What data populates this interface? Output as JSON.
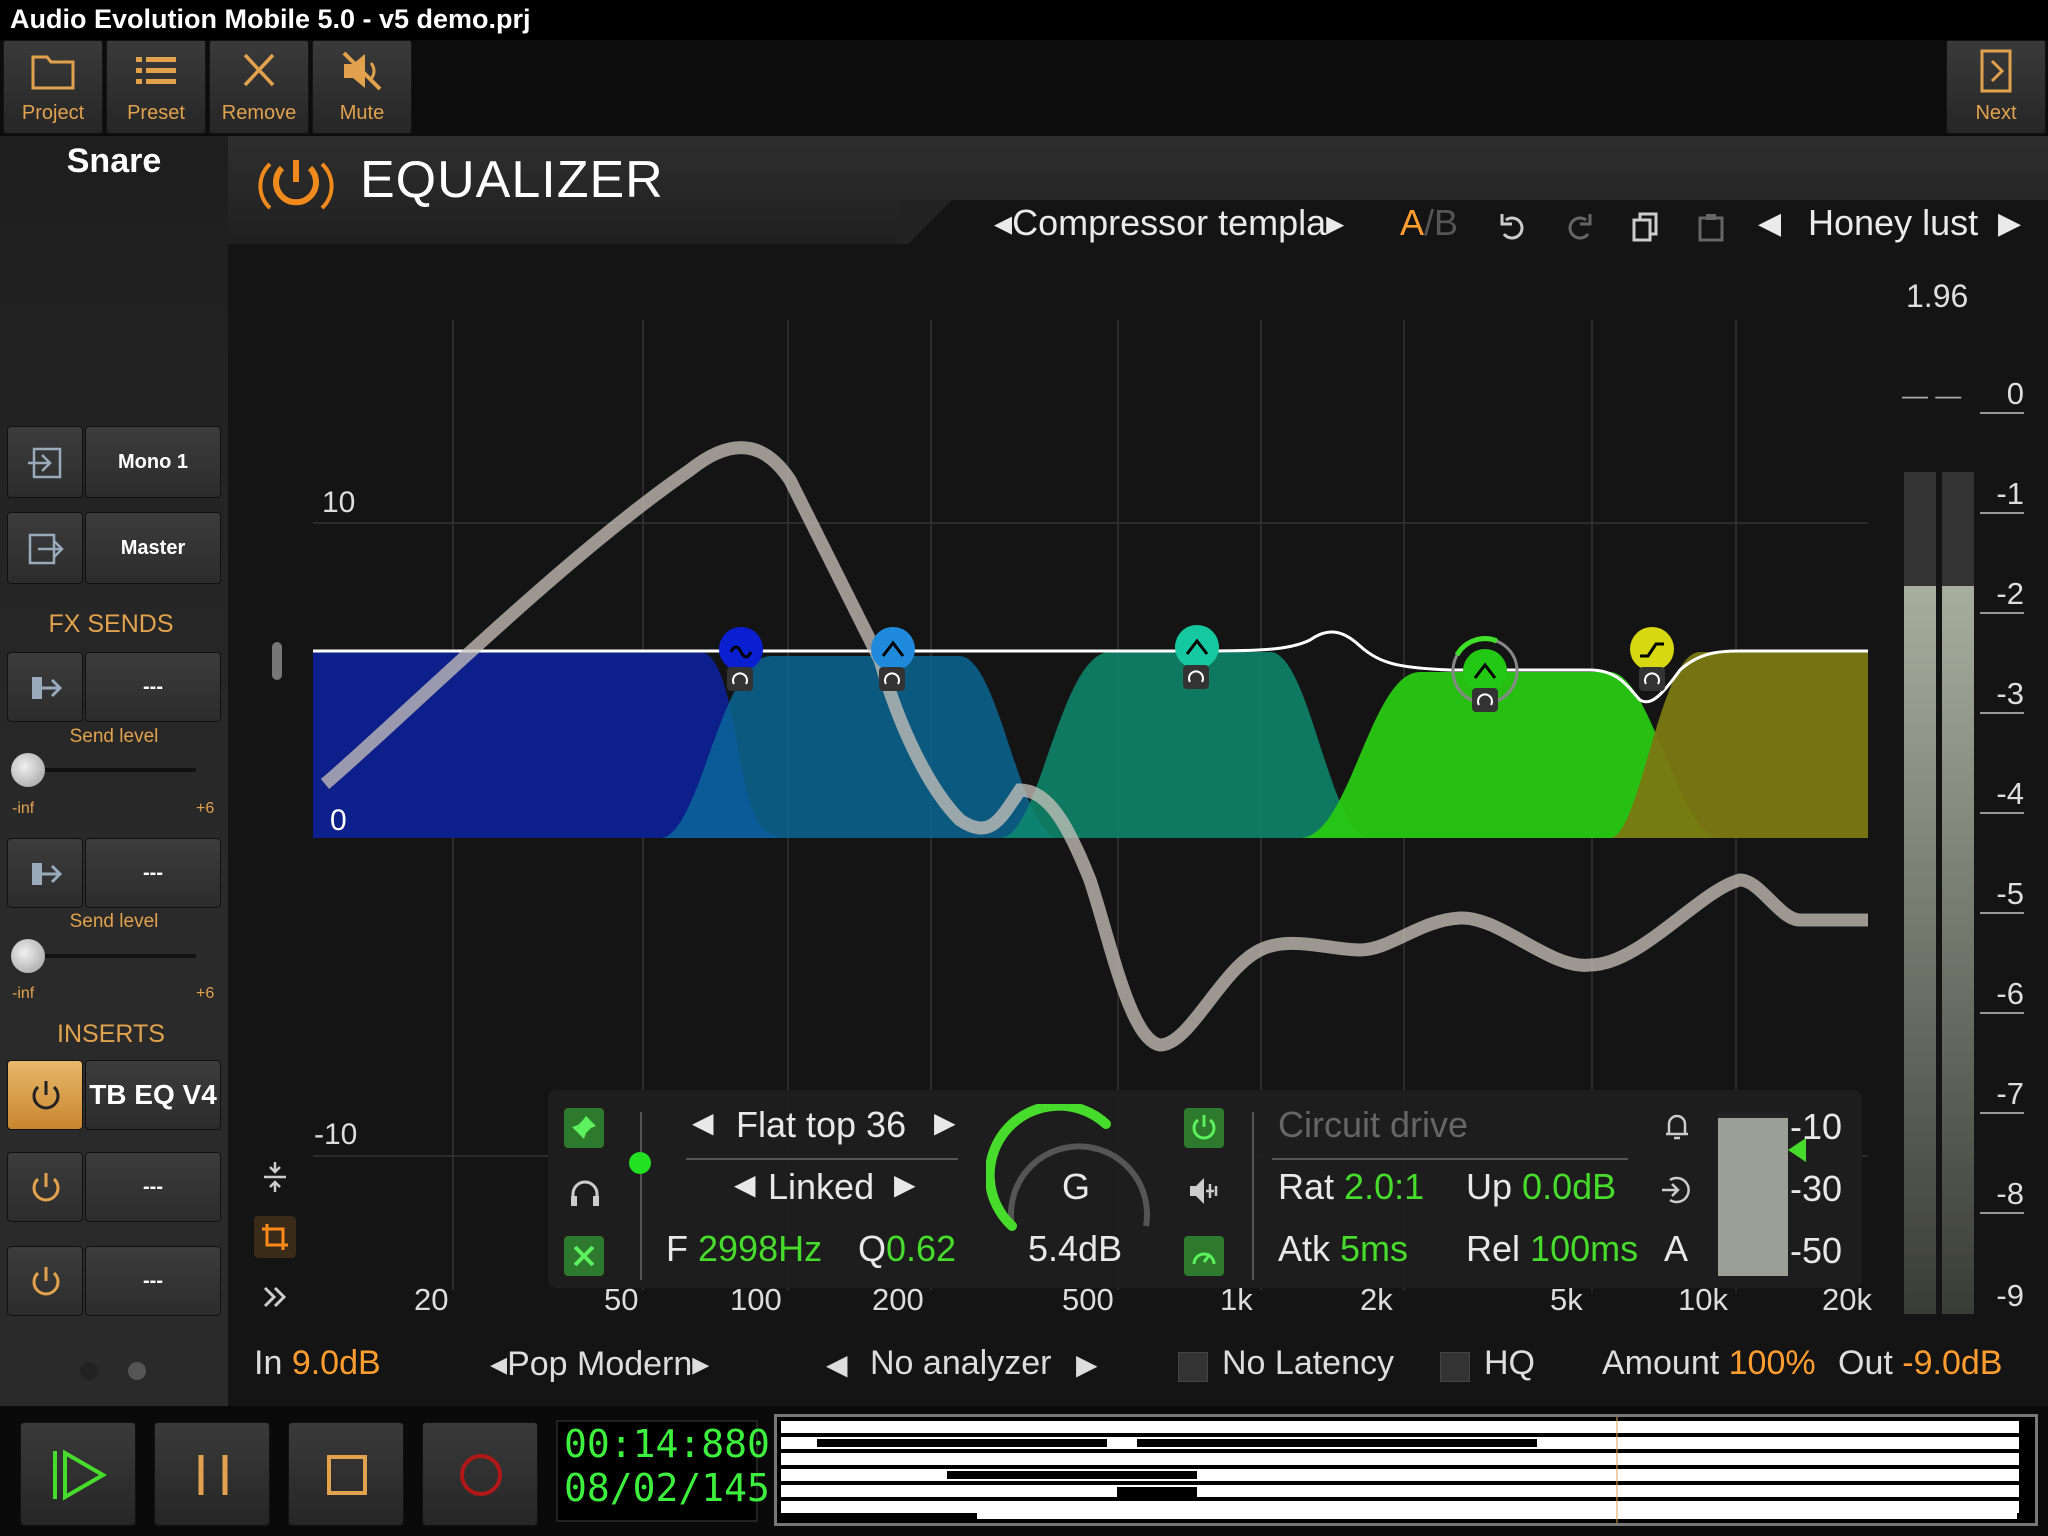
{
  "window": {
    "title": "Audio Evolution Mobile 5.0 - v5 demo.prj"
  },
  "toolbar": {
    "project": "Project",
    "preset": "Preset",
    "remove": "Remove",
    "mute": "Mute",
    "next": "Next"
  },
  "sidebar": {
    "track_name": "Snare",
    "input": "Mono 1",
    "output": "Master",
    "fx_sends_heading": "FX SENDS",
    "sends": [
      {
        "target": "---",
        "label": "Send level",
        "min": "-inf",
        "max": "+6",
        "level": 0
      },
      {
        "target": "---",
        "label": "Send level",
        "min": "-inf",
        "max": "+6",
        "level": 0
      }
    ],
    "inserts_heading": "INSERTS",
    "inserts": [
      {
        "name": "TB EQ V4",
        "active": true
      },
      {
        "name": "---",
        "active": false
      },
      {
        "name": "---",
        "active": false
      }
    ]
  },
  "plugin": {
    "title": "EQUALIZER",
    "preset_name": "◂Compressor templa▸",
    "ab_a": "A",
    "ab_sep": "/",
    "ab_b": "B",
    "factory_prev": "◀",
    "factory_preset": "Honey lust",
    "factory_next": "▶",
    "meter_peak": "1.96",
    "meter_dashes": "— —",
    "meter_scale": [
      "0",
      "-1",
      "-2",
      "-3",
      "-4",
      "-5",
      "-6",
      "-7",
      "-8",
      "-9"
    ],
    "db_labels": {
      "top": "10",
      "mid": "0",
      "bottom": "-10"
    },
    "freq_labels": [
      "20",
      "50",
      "100",
      "200",
      "500",
      "1k",
      "2k",
      "5k",
      "10k",
      "20k"
    ]
  },
  "band_panel": {
    "filter_prev": "◀",
    "filter_type": "Flat top 36",
    "filter_next": "▶",
    "link_prev": "◀",
    "link_mode": "Linked",
    "link_next": "▶",
    "freq_label": "F",
    "freq_value": "2998Hz",
    "q_label": "Q",
    "q_value": "0.62",
    "gain_knob_label": "G",
    "gain_value": "5.4dB",
    "dynamics_title": "Circuit drive",
    "ratio_label": "Rat",
    "ratio_value": "2.0:1",
    "up_label": "Up",
    "up_value": "0.0dB",
    "attack_label": "Atk",
    "attack_value": "5ms",
    "release_label": "Rel",
    "release_value": "100ms",
    "auto_label": "A",
    "threshold_scale": [
      "-10",
      "-30",
      "-50"
    ]
  },
  "status_bar": {
    "in_label": "In",
    "in_value": "9.0dB",
    "style_preset": "◂Pop Modern▸",
    "analyzer_prev": "◀",
    "analyzer": "No analyzer",
    "analyzer_next": "▶",
    "no_latency": "No Latency",
    "hq": "HQ",
    "amount_label": "Amount",
    "amount_value": "100%",
    "out_label": "Out",
    "out_value": "-9.0dB"
  },
  "transport": {
    "time": "00:14:880",
    "bars": "08/02/145"
  },
  "colors": {
    "accent_orange": "#e2a24d",
    "value_green": "#47dc2c",
    "band1": "#0c1f8a",
    "band2": "#0a5a86",
    "band3": "#0e7a63",
    "band4": "#2bbd12",
    "band5": "#7a7a12"
  }
}
